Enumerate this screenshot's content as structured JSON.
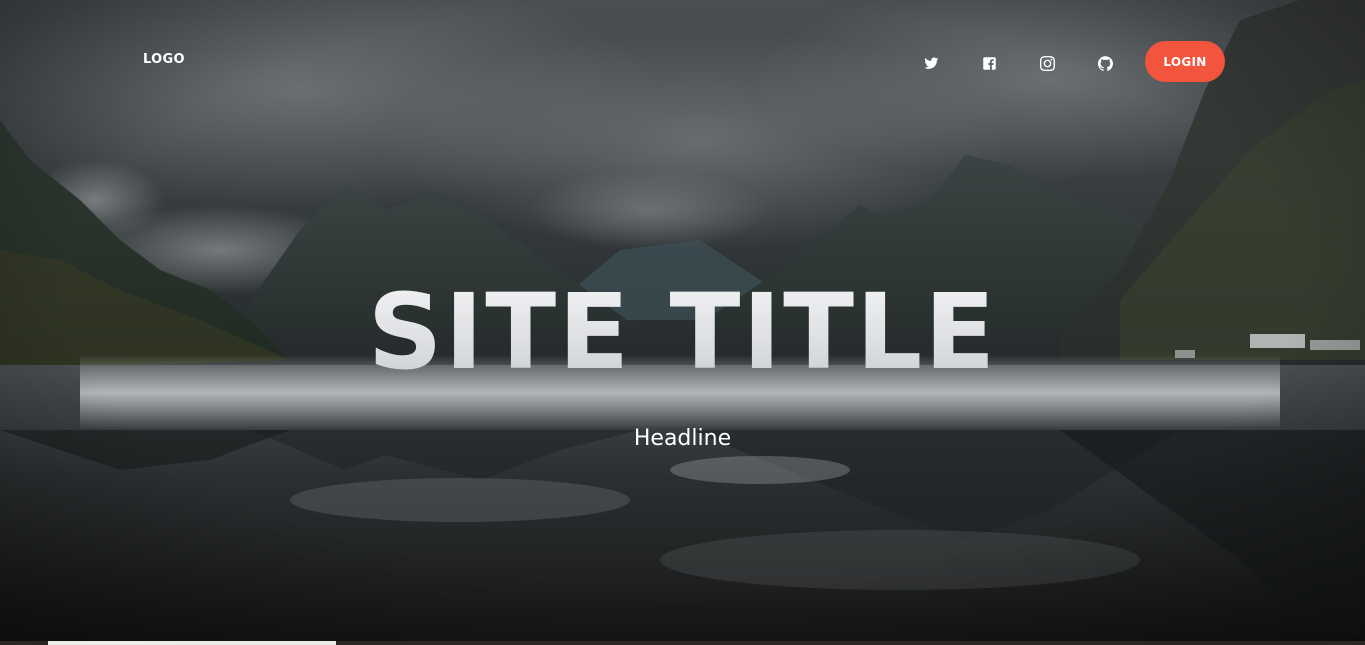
{
  "nav": {
    "logo": "LOGO",
    "social_icons": [
      "twitter-icon",
      "facebook-icon",
      "instagram-icon",
      "github-icon"
    ],
    "login_label": "LOGIN"
  },
  "hero": {
    "title": "SITE TITLE",
    "headline": "Headline"
  },
  "colors": {
    "accent": "#f2543e",
    "text": "#ffffff"
  }
}
